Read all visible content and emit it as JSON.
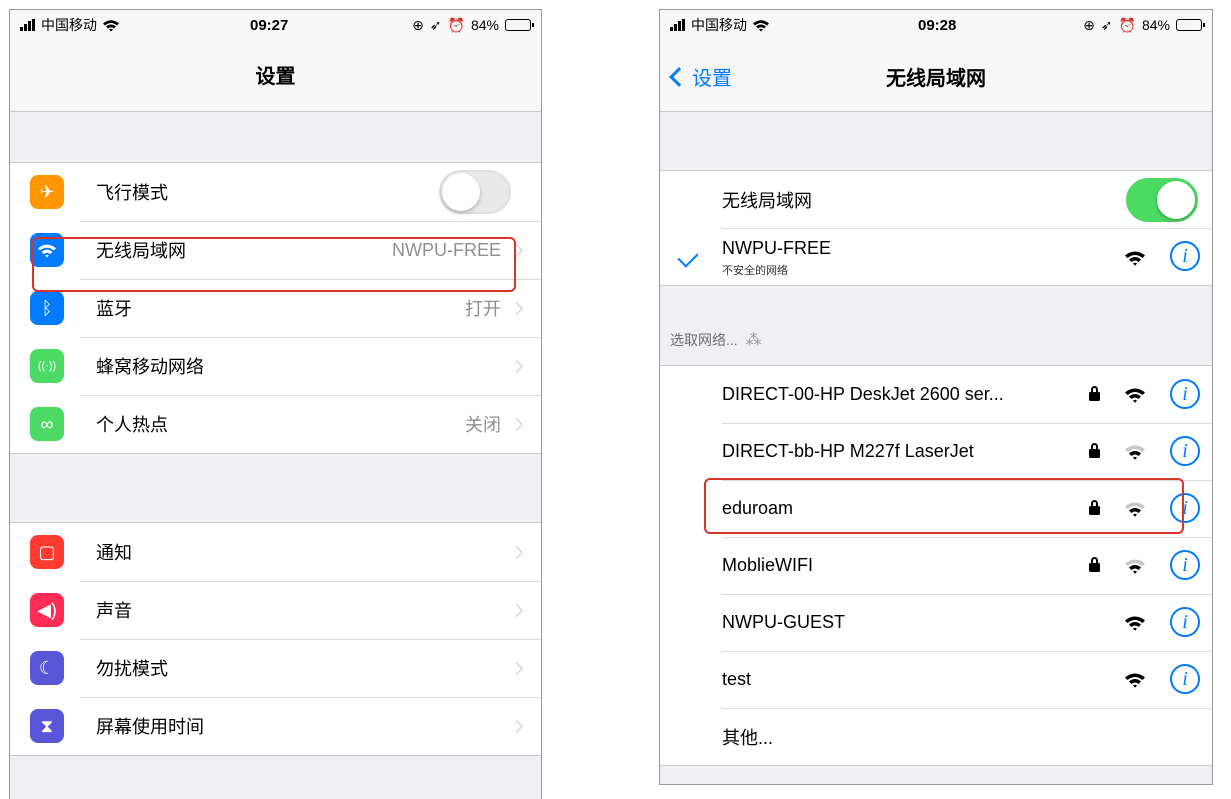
{
  "left_screen": {
    "status": {
      "carrier": "中国移动",
      "time": "09:27",
      "battery": "84%",
      "battery_level": 0.84
    },
    "title": "设置",
    "groups": [
      [
        {
          "label": "飞行模式",
          "icon": "airplane-icon",
          "color": "#ff9500",
          "toggle": false
        },
        {
          "label": "无线局域网",
          "icon": "wifi-icon",
          "color": "#007aff",
          "value": "NWPU-FREE"
        },
        {
          "label": "蓝牙",
          "icon": "bluetooth-icon",
          "color": "#007aff",
          "value": "打开"
        },
        {
          "label": "蜂窝移动网络",
          "icon": "cellular-icon",
          "color": "#4cd964",
          "value": ""
        },
        {
          "label": "个人热点",
          "icon": "hotspot-icon",
          "color": "#4cd964",
          "value": "关闭"
        }
      ],
      [
        {
          "label": "通知",
          "icon": "notification-icon",
          "color": "#ff3b30",
          "value": ""
        },
        {
          "label": "声音",
          "icon": "sound-icon",
          "color": "#ff2d55",
          "value": ""
        },
        {
          "label": "勿扰模式",
          "icon": "moon-icon",
          "color": "#5856d6",
          "value": ""
        },
        {
          "label": "屏幕使用时间",
          "icon": "hourglass-icon",
          "color": "#5856d6",
          "value": ""
        }
      ]
    ]
  },
  "right_screen": {
    "status": {
      "carrier": "中国移动",
      "time": "09:28",
      "battery": "84%",
      "battery_level": 0.84
    },
    "back": "设置",
    "title": "无线局域网",
    "wifi_toggle_label": "无线局域网",
    "wifi_on": true,
    "connected": {
      "name": "NWPU-FREE",
      "subtitle": "不安全的网络"
    },
    "choose_header": "选取网络...",
    "networks": [
      {
        "name": "DIRECT-00-HP DeskJet 2600 ser...",
        "locked": true,
        "signal": 3
      },
      {
        "name": "DIRECT-bb-HP M227f LaserJet",
        "locked": true,
        "signal": 2
      },
      {
        "name": "eduroam",
        "locked": true,
        "signal": 2
      },
      {
        "name": "MoblieWIFI",
        "locked": true,
        "signal": 2
      },
      {
        "name": "NWPU-GUEST",
        "locked": false,
        "signal": 3
      },
      {
        "name": "test",
        "locked": false,
        "signal": 3
      },
      {
        "name": "其他...",
        "locked": false,
        "signal": 0,
        "other": true
      }
    ]
  },
  "colors": {
    "accent": "#007aff",
    "highlight": "#d9342b",
    "toggle_on": "#4cd964"
  }
}
